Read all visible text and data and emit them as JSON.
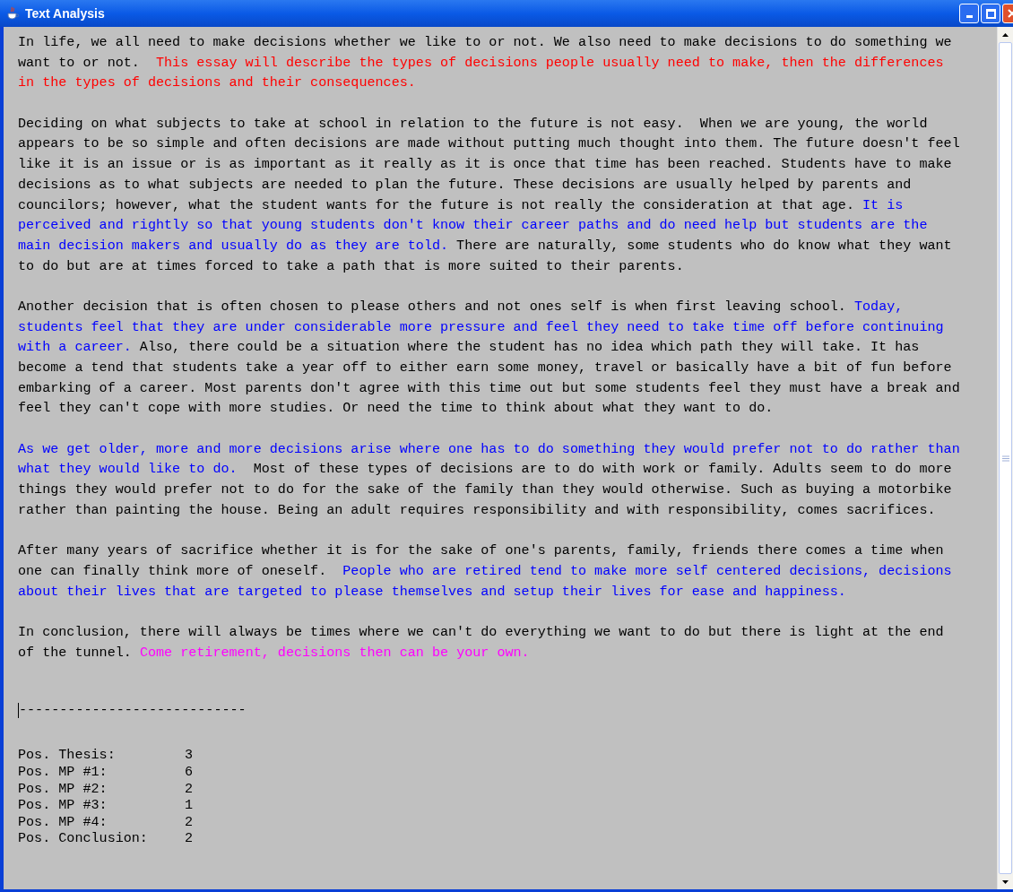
{
  "window": {
    "title": "Text Analysis"
  },
  "essay": {
    "paragraphs": [
      {
        "lines": [
          [
            {
              "text": "In life, we all need to make decisions whether we like to or not. We also need to make decisions to do something we",
              "color": "#000000"
            }
          ],
          [
            {
              "text": "want to or not.  ",
              "color": "#000000"
            },
            {
              "text": "This essay will describe the types of decisions people usually need to make, then the differences",
              "color": "#ff0000"
            }
          ],
          [
            {
              "text": "in the types of decisions and their consequences.",
              "color": "#ff0000"
            }
          ]
        ]
      },
      {
        "lines": [
          [
            {
              "text": "Deciding on what subjects to take at school in relation to the future is not easy.  When we are young, the world",
              "color": "#000000"
            }
          ],
          [
            {
              "text": "appears to be so simple and often decisions are made without putting much thought into them. The future doesn't feel",
              "color": "#000000"
            }
          ],
          [
            {
              "text": "like it is an issue or is as important as it really as it is once that time has been reached. Students have to make",
              "color": "#000000"
            }
          ],
          [
            {
              "text": "decisions as to what subjects are needed to plan the future. These decisions are usually helped by parents and",
              "color": "#000000"
            }
          ],
          [
            {
              "text": "councilors; however, what the student wants for the future is not really the consideration at that age. ",
              "color": "#000000"
            },
            {
              "text": "It is",
              "color": "#0000ff"
            }
          ],
          [
            {
              "text": "perceived and rightly so that young students don't know their career paths and do need help but students are the",
              "color": "#0000ff"
            }
          ],
          [
            {
              "text": "main decision makers and usually do as they are told.",
              "color": "#0000ff"
            },
            {
              "text": " There are naturally, some students who do know what they want",
              "color": "#000000"
            }
          ],
          [
            {
              "text": "to do but are at times forced to take a path that is more suited to their parents.",
              "color": "#000000"
            }
          ]
        ]
      },
      {
        "lines": [
          [
            {
              "text": "Another decision that is often chosen to please others and not ones self is when first leaving school. ",
              "color": "#000000"
            },
            {
              "text": "Today,",
              "color": "#0000ff"
            }
          ],
          [
            {
              "text": "students feel that they are under considerable more pressure and feel they need to take time off before continuing",
              "color": "#0000ff"
            }
          ],
          [
            {
              "text": "with a career.",
              "color": "#0000ff"
            },
            {
              "text": " Also, there could be a situation where the student has no idea which path they will take. It has",
              "color": "#000000"
            }
          ],
          [
            {
              "text": "become a tend that students take a year off to either earn some money, travel or basically have a bit of fun before",
              "color": "#000000"
            }
          ],
          [
            {
              "text": "embarking of a career. Most parents don't agree with this time out but some students feel they must have a break and",
              "color": "#000000"
            }
          ],
          [
            {
              "text": "feel they can't cope with more studies. Or need the time to think about what they want to do.",
              "color": "#000000"
            }
          ]
        ]
      },
      {
        "lines": [
          [
            {
              "text": "As we get older, more and more decisions arise where one has to do something they would prefer not to do rather than",
              "color": "#0000ff"
            }
          ],
          [
            {
              "text": "what they would like to do.",
              "color": "#0000ff"
            },
            {
              "text": "  Most of these types of decisions are to do with work or family. Adults seem to do more",
              "color": "#000000"
            }
          ],
          [
            {
              "text": "things they would prefer not to do for the sake of the family than they would otherwise. Such as buying a motorbike",
              "color": "#000000"
            }
          ],
          [
            {
              "text": "rather than painting the house. Being an adult requires responsibility and with responsibility, comes sacrifices.",
              "color": "#000000"
            }
          ]
        ]
      },
      {
        "lines": [
          [
            {
              "text": "After many years of sacrifice whether it is for the sake of one's parents, family, friends there comes a time when",
              "color": "#000000"
            }
          ],
          [
            {
              "text": "one can finally think more of oneself.  ",
              "color": "#000000"
            },
            {
              "text": "People who are retired tend to make more self centered decisions, decisions",
              "color": "#0000ff"
            }
          ],
          [
            {
              "text": "about their lives that are targeted to please themselves and setup their lives for ease and happiness.",
              "color": "#0000ff"
            }
          ]
        ]
      },
      {
        "lines": [
          [
            {
              "text": "In conclusion, there will always be times where we can't do everything we want to do but there is light at the end",
              "color": "#000000"
            }
          ],
          [
            {
              "text": "of the tunnel. ",
              "color": "#000000"
            },
            {
              "text": "Come retirement, decisions then can be your own.",
              "color": "#ff00ff"
            }
          ]
        ]
      }
    ]
  },
  "separator": "----------------------------",
  "results": [
    {
      "label": "Pos. Thesis:",
      "value": "3"
    },
    {
      "label": "Pos. MP #1:",
      "value": "6"
    },
    {
      "label": "Pos. MP #2:",
      "value": "2"
    },
    {
      "label": "Pos. MP #3:",
      "value": "1"
    },
    {
      "label": "Pos. MP #4:",
      "value": "2"
    },
    {
      "label": "Pos. Conclusion:",
      "value": "2"
    }
  ]
}
